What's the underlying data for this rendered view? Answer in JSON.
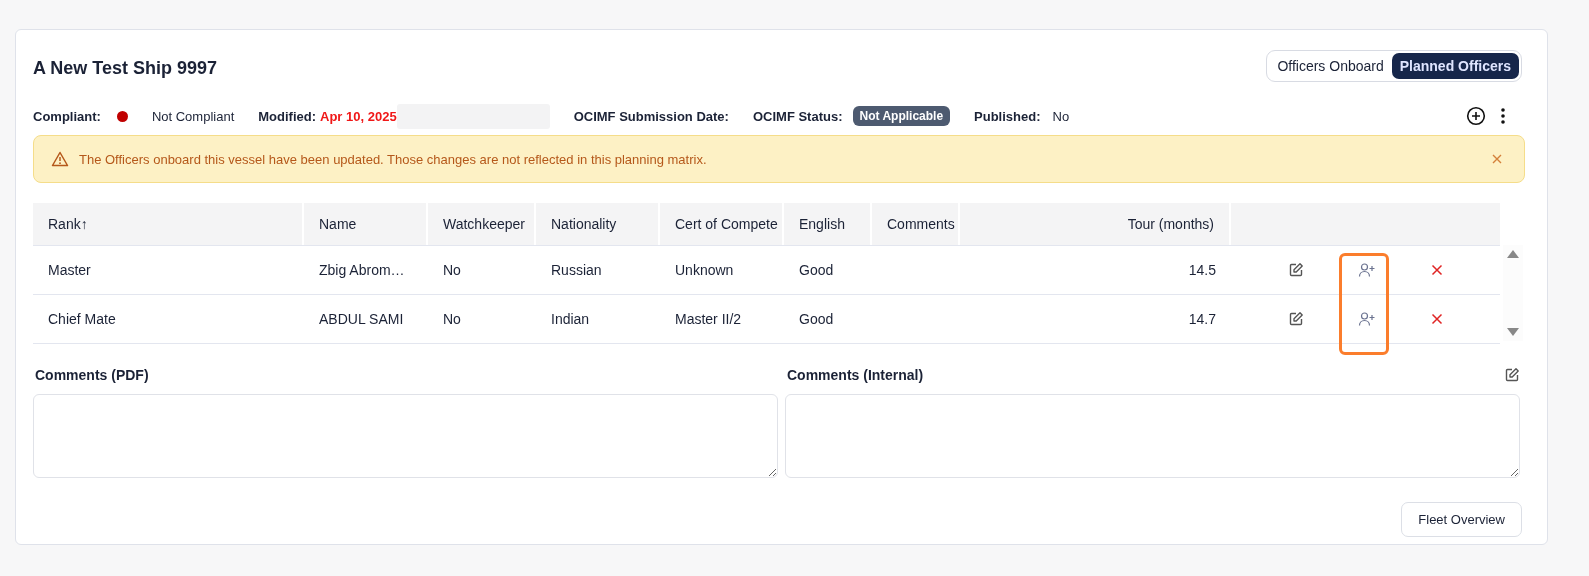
{
  "title": "A New Test Ship 9997",
  "tabs": [
    {
      "label": "Officers Onboard",
      "selected": false
    },
    {
      "label": "Planned Officers",
      "selected": true
    }
  ],
  "meta": {
    "compliant_label": "Compliant:",
    "compliant": false,
    "compliant_text": "Not Compliant",
    "modified_label": "Modified:",
    "modified_value": "Apr 10, 2025",
    "ocimf_date_label": "OCIMF Submission Date:",
    "ocimf_status_label": "OCIMF Status:",
    "ocimf_status": "Not Applicable",
    "published_label": "Published:",
    "published_value": "No"
  },
  "alert": {
    "text": "The Officers onboard this vessel have been updated. Those changes are not reflected in this planning matrix."
  },
  "table": {
    "columns": [
      {
        "label": "Rank↑"
      },
      {
        "label": "Name"
      },
      {
        "label": "Watchkeeper"
      },
      {
        "label": "Nationality"
      },
      {
        "label": "Cert of Compete"
      },
      {
        "label": "English"
      },
      {
        "label": "Comments"
      },
      {
        "label": "Tour (months)"
      }
    ],
    "rows": [
      {
        "cells": [
          "Master",
          "Zbig Abrom…",
          "No",
          "Russian",
          "Unknown",
          "Good",
          "",
          "14.5"
        ]
      },
      {
        "cells": [
          "Chief Mate",
          "ABDUL SAMI",
          "No",
          "Indian",
          "Master II/2",
          "Good",
          "",
          "14.7"
        ]
      }
    ]
  },
  "comments": [
    {
      "label": "Comments (PDF)",
      "editable": false
    },
    {
      "label": "Comments (Internal)",
      "editable": true
    }
  ],
  "footer_button": "Fleet Overview"
}
